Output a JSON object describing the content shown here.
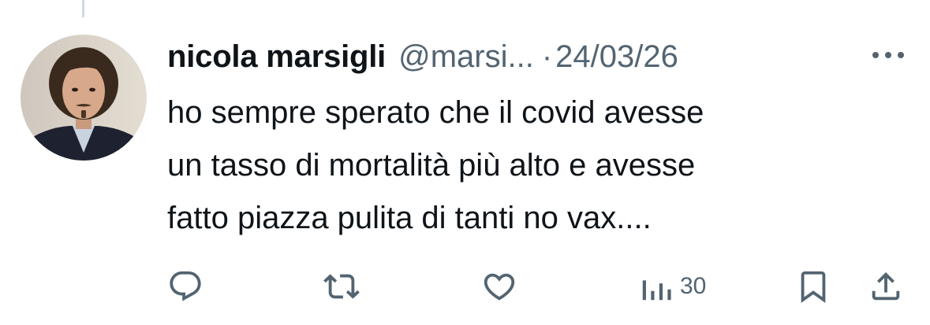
{
  "tweet": {
    "display_name": "nicola marsigli",
    "handle": "@marsi...",
    "separator": "·",
    "date": "24/03/26",
    "text_lines": [
      "ho sempre sperato che il covid avesse",
      "un tasso di mortalità più alto e avesse",
      "fatto piazza pulita di tanti no vax...."
    ]
  },
  "actions": {
    "views_count": "30"
  },
  "icons": {
    "more": "more-horizontal-icon",
    "reply": "reply-icon",
    "retweet": "retweet-icon",
    "like": "heart-icon",
    "views": "views-bar-chart-icon",
    "bookmark": "bookmark-icon",
    "share": "share-icon"
  },
  "colors": {
    "text_primary": "#0f1419",
    "text_secondary": "#536471",
    "thread_line": "#cfd9de"
  }
}
